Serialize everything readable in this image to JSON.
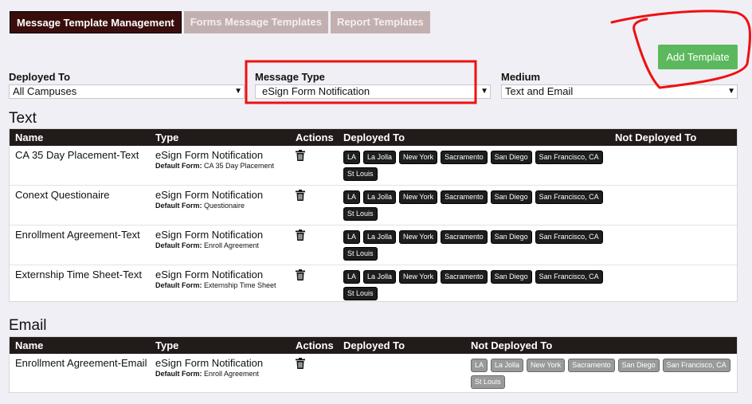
{
  "tabs": [
    {
      "label": "Message Template Management",
      "active": true
    },
    {
      "label": "Forms Message Templates",
      "active": false
    },
    {
      "label": "Report Templates",
      "active": false
    }
  ],
  "add_button": "Add Template",
  "filters": {
    "deployed_to": {
      "label": "Deployed To",
      "value": "All Campuses"
    },
    "message_type": {
      "label": "Message Type",
      "value": "eSign Form Notification"
    },
    "medium": {
      "label": "Medium",
      "value": "Text and Email"
    }
  },
  "columns": {
    "name": "Name",
    "type": "Type",
    "actions": "Actions",
    "deployed": "Deployed To",
    "not_deployed": "Not Deployed To"
  },
  "default_form_label": "Default Form:",
  "campuses": [
    "LA",
    "La Jolla",
    "New York",
    "Sacramento",
    "San Diego",
    "San Francisco, CA",
    "St Louis"
  ],
  "text_section": {
    "title": "Text",
    "rows": [
      {
        "name": "CA 35 Day Placement-Text",
        "type": "eSign Form Notification",
        "default_form": "CA 35 Day Placement"
      },
      {
        "name": "Conext Questionaire",
        "type": "eSign Form Notification",
        "default_form": "Questionaire"
      },
      {
        "name": "Enrollment Agreement-Text",
        "type": "eSign Form Notification",
        "default_form": "Enroll Agreement"
      },
      {
        "name": "Externship Time Sheet-Text",
        "type": "eSign Form Notification",
        "default_form": "Externship Time Sheet"
      }
    ]
  },
  "email_section": {
    "title": "Email",
    "rows": [
      {
        "name": "Enrollment Agreement-Email",
        "type": "eSign Form Notification",
        "default_form": "Enroll Agreement"
      }
    ]
  },
  "colors": {
    "tab_active": "#3a0d0d",
    "tab_inactive": "#c2b0b0",
    "add_button": "#5cb85c",
    "table_header": "#231a1a",
    "annotation": "#ee1111"
  }
}
